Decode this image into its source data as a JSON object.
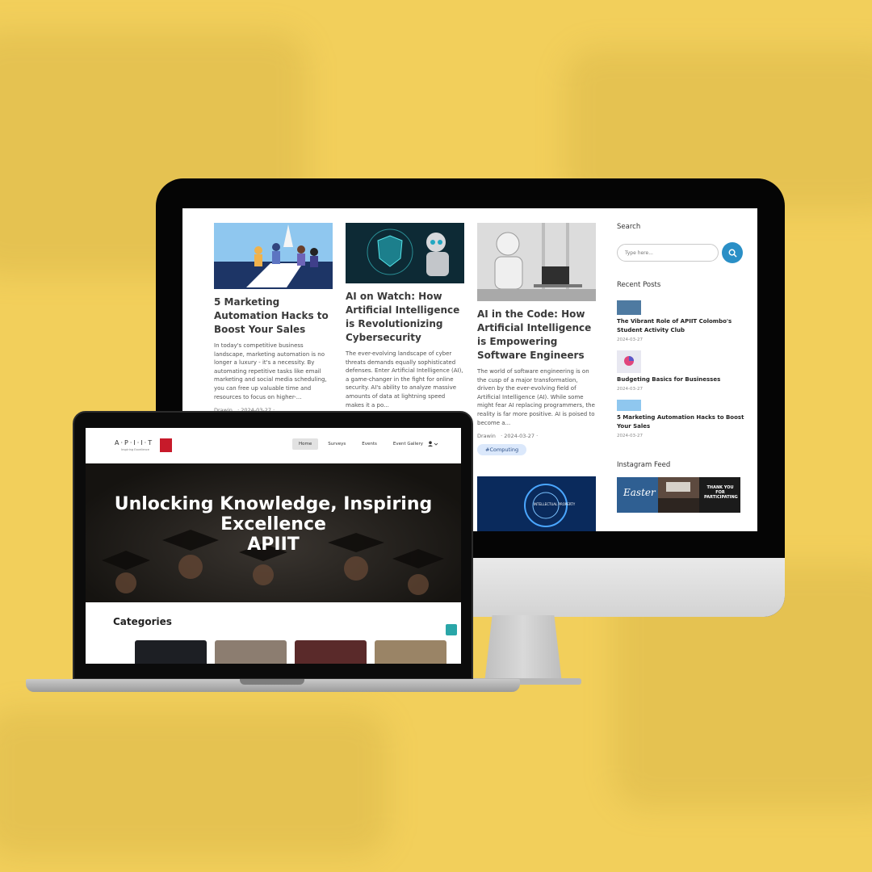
{
  "desktop": {
    "posts": [
      {
        "title": "5 Marketing Automation Hacks to Boost Your Sales",
        "excerpt": "In today's competitive business landscape, marketing automation is no longer a luxury - it's a necessity. By automating repetitive tasks like email marketing and social media scheduling, you can free up valuable time and resources to focus on higher-...",
        "author": "Drawin",
        "date": "· 2024-03-27 ·"
      },
      {
        "title": "AI on Watch: How Artificial Intelligence is Revolutionizing Cybersecurity",
        "excerpt": "The ever-evolving landscape of cyber threats demands equally sophisticated defenses. Enter Artificial Intelligence (AI), a game-changer in the fight for online security. AI's ability to analyze massive amounts of data at lightning speed makes it a po...",
        "author": "",
        "date": ""
      },
      {
        "title": "AI in the Code: How Artificial Intelligence is Empowering Software Engineers",
        "excerpt": "The world of software engineering is on the cusp of a major transformation, driven by the ever-evolving field of Artificial Intelligence (AI). While some might fear AI replacing programmers, the reality is far more positive. AI is poised to become a...",
        "author": "Drawin",
        "date": "· 2024-03-27 ·",
        "tag": "#Computing"
      }
    ],
    "sidebar": {
      "search_heading": "Search",
      "search_placeholder": "Type here...",
      "recent_heading": "Recent Posts",
      "recent_posts": [
        {
          "title": "The Vibrant Role of APIIT Colombo's Student Activity Club",
          "date": "2024-03-27"
        },
        {
          "title": "Budgeting Basics for Businesses",
          "date": "2024-03-27"
        },
        {
          "title": "5 Marketing Automation Hacks to Boost Your Sales",
          "date": "2024-03-27"
        }
      ],
      "instagram_heading": "Instagram Feed",
      "instagram_tiles": [
        {
          "text": "Easter"
        },
        {
          "text": ""
        },
        {
          "text": "THANK YOU FOR PARTICIPATING"
        }
      ]
    },
    "fourth_card_image_text": "INTELLECTUAL PROPERTY"
  },
  "laptop": {
    "logo_text": "A·P·I·I·T",
    "logo_sub": "Inspiring Excellence",
    "nav": [
      "Home",
      "Surveys",
      "Events",
      "Event Gallery"
    ],
    "user_menu": "⚲ ▾",
    "hero_title_line1": "Unlocking Knowledge, Inspiring",
    "hero_title_line2": "Excellence",
    "hero_title_line3": "APIIT",
    "categories_title": "Categories"
  },
  "colors": {
    "background": "#f2cf5b",
    "accent_blue": "#2a8fc6",
    "tag_bg": "#dbe8fb",
    "brand_red": "#c71a2a"
  }
}
